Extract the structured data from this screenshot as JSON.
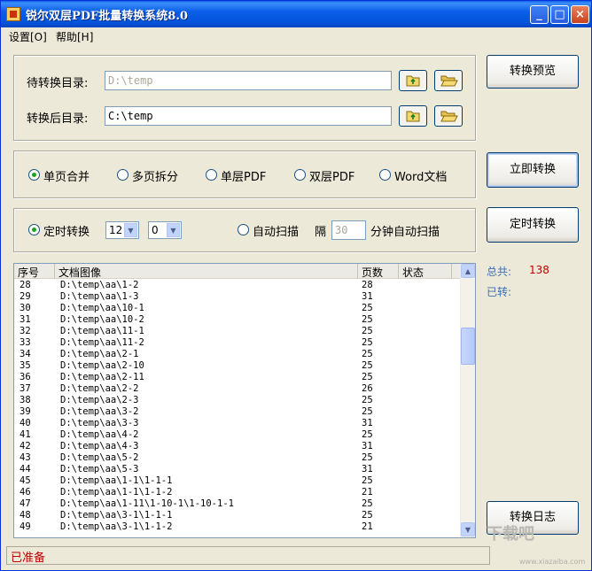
{
  "window": {
    "title": "锐尔双层PDF批量转换系统8.0"
  },
  "menu": [
    {
      "label": "设置[O]"
    },
    {
      "label": "帮助[H]"
    }
  ],
  "directories": {
    "source_label": "待转换目录:",
    "source_value": "D:\\temp",
    "target_label": "转换后目录:",
    "target_value": "C:\\temp"
  },
  "mode_options": [
    {
      "label": "单页合并",
      "checked": true
    },
    {
      "label": "多页拆分",
      "checked": false
    },
    {
      "label": "单层PDF",
      "checked": false
    },
    {
      "label": "双层PDF",
      "checked": false
    },
    {
      "label": "Word文档",
      "checked": false
    }
  ],
  "schedule": {
    "timed_label": "定时转换",
    "timed_checked": true,
    "hour": "12",
    "minute": "0",
    "auto_scan_label": "自动扫描",
    "interval_label": "隔",
    "interval_value": "30",
    "interval_suffix": "分钟自动扫描"
  },
  "buttons": {
    "preview": "转换预览",
    "convert_now": "立即转换",
    "timed_convert": "定时转换",
    "log": "转换日志"
  },
  "stats": {
    "total_label": "总共:",
    "total_value": "138",
    "done_label": "已转:"
  },
  "table": {
    "columns": [
      "序号",
      "文档图像",
      "页数",
      "状态"
    ],
    "rows": [
      {
        "seq": "28",
        "image": "D:\\temp\\aa\\1-2",
        "pages": "28",
        "status": ""
      },
      {
        "seq": "29",
        "image": "D:\\temp\\aa\\1-3",
        "pages": "31",
        "status": ""
      },
      {
        "seq": "30",
        "image": "D:\\temp\\aa\\10-1",
        "pages": "25",
        "status": ""
      },
      {
        "seq": "31",
        "image": "D:\\temp\\aa\\10-2",
        "pages": "25",
        "status": ""
      },
      {
        "seq": "32",
        "image": "D:\\temp\\aa\\11-1",
        "pages": "25",
        "status": ""
      },
      {
        "seq": "33",
        "image": "D:\\temp\\aa\\11-2",
        "pages": "25",
        "status": ""
      },
      {
        "seq": "34",
        "image": "D:\\temp\\aa\\2-1",
        "pages": "25",
        "status": ""
      },
      {
        "seq": "35",
        "image": "D:\\temp\\aa\\2-10",
        "pages": "25",
        "status": ""
      },
      {
        "seq": "36",
        "image": "D:\\temp\\aa\\2-11",
        "pages": "25",
        "status": ""
      },
      {
        "seq": "37",
        "image": "D:\\temp\\aa\\2-2",
        "pages": "26",
        "status": ""
      },
      {
        "seq": "38",
        "image": "D:\\temp\\aa\\2-3",
        "pages": "25",
        "status": ""
      },
      {
        "seq": "39",
        "image": "D:\\temp\\aa\\3-2",
        "pages": "25",
        "status": ""
      },
      {
        "seq": "40",
        "image": "D:\\temp\\aa\\3-3",
        "pages": "31",
        "status": ""
      },
      {
        "seq": "41",
        "image": "D:\\temp\\aa\\4-2",
        "pages": "25",
        "status": ""
      },
      {
        "seq": "42",
        "image": "D:\\temp\\aa\\4-3",
        "pages": "31",
        "status": ""
      },
      {
        "seq": "43",
        "image": "D:\\temp\\aa\\5-2",
        "pages": "25",
        "status": ""
      },
      {
        "seq": "44",
        "image": "D:\\temp\\aa\\5-3",
        "pages": "31",
        "status": ""
      },
      {
        "seq": "45",
        "image": "D:\\temp\\aa\\1-1\\1-1-1",
        "pages": "25",
        "status": ""
      },
      {
        "seq": "46",
        "image": "D:\\temp\\aa\\1-1\\1-1-2",
        "pages": "21",
        "status": ""
      },
      {
        "seq": "47",
        "image": "D:\\temp\\aa\\1-11\\1-10-1\\1-10-1-1",
        "pages": "25",
        "status": ""
      },
      {
        "seq": "48",
        "image": "D:\\temp\\aa\\3-1\\1-1-1",
        "pages": "25",
        "status": ""
      },
      {
        "seq": "49",
        "image": "D:\\temp\\aa\\3-1\\1-1-2",
        "pages": "21",
        "status": ""
      }
    ]
  },
  "status": {
    "text": "已准备"
  },
  "watermark": {
    "text": "下载吧",
    "url": "www.xiazaiba.com"
  }
}
